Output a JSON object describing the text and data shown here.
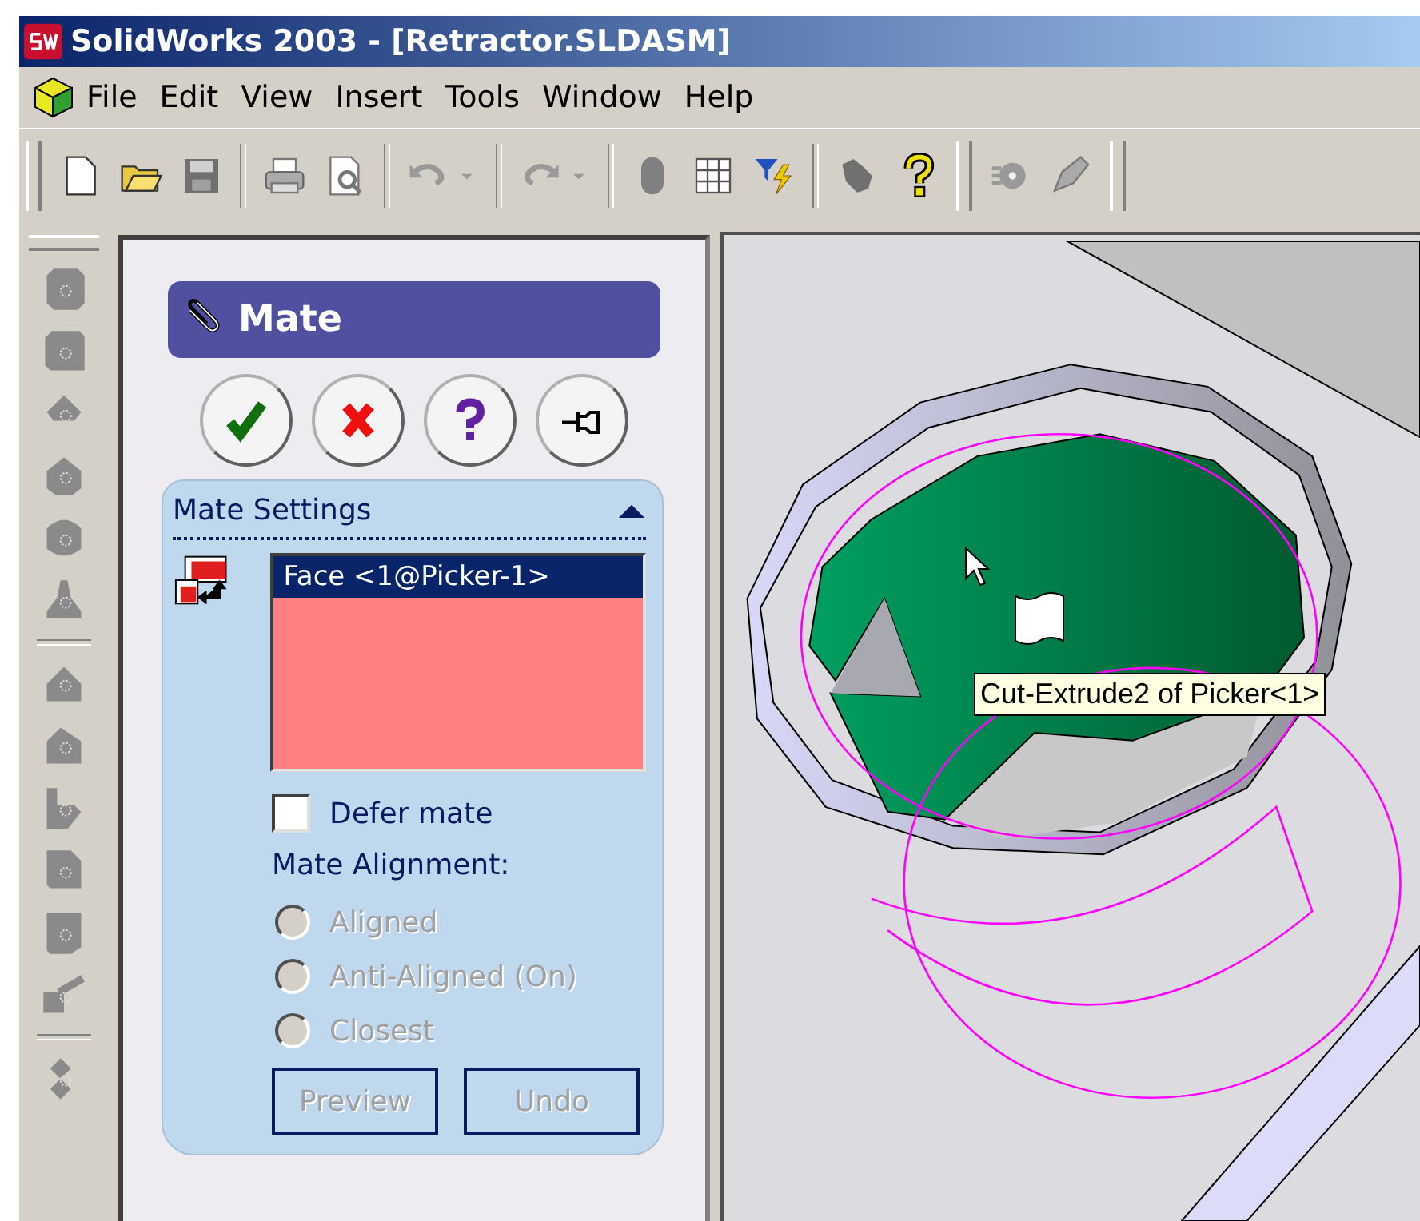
{
  "window": {
    "title": "SolidWorks 2003 - [Retractor.SLDASM]"
  },
  "menu": [
    "File",
    "Edit",
    "View",
    "Insert",
    "Tools",
    "Window",
    "Help"
  ],
  "property_manager": {
    "title": "Mate",
    "section": {
      "title": "Mate Settings",
      "expanded": true,
      "selections": [
        {
          "label": "Face <1@Picker-1>",
          "selected": true
        }
      ],
      "defer_mate": {
        "label": "Defer mate",
        "checked": false
      },
      "alignment_label": "Mate Alignment:",
      "alignment_options": [
        {
          "label": "Aligned",
          "selected": false,
          "disabled": true
        },
        {
          "label": "Anti-Aligned (On)",
          "selected": false,
          "disabled": true
        },
        {
          "label": "Closest",
          "selected": false,
          "disabled": true
        }
      ],
      "buttons": [
        {
          "label": "Preview",
          "disabled": true
        },
        {
          "label": "Undo",
          "disabled": true
        }
      ]
    }
  },
  "viewport": {
    "tooltip": "Cut-Extrude2 of Picker<1>"
  }
}
